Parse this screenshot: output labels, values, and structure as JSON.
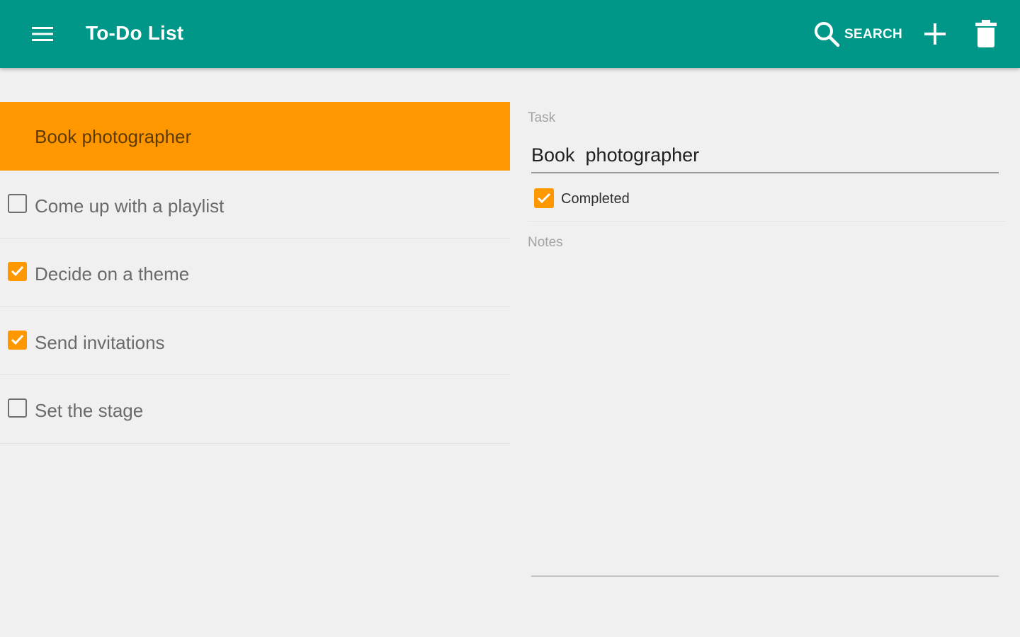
{
  "appbar": {
    "title": "To-Do List",
    "menu_icon": "menu-icon",
    "search_icon": "search-icon",
    "search_label": "SEARCH",
    "add_icon": "add-icon",
    "delete_icon": "delete-icon",
    "background_color": "#009688"
  },
  "tasks": [
    {
      "label": "Book  photographer",
      "completed": true,
      "selected": true
    },
    {
      "label": "Come up with a playlist",
      "completed": false,
      "selected": false
    },
    {
      "label": "Decide on a theme",
      "completed": true,
      "selected": false
    },
    {
      "label": "Send invitations",
      "completed": true,
      "selected": false
    },
    {
      "label": "Set the stage",
      "completed": false,
      "selected": false
    }
  ],
  "detail": {
    "task_caption": "Task",
    "task_value": "Book  photographer",
    "completed_label": "Completed",
    "completed_checked": true,
    "notes_caption": "Notes",
    "notes_value": ""
  },
  "colors": {
    "accent": "#ff9800",
    "primary": "#009688",
    "background": "#f0f0f0"
  }
}
